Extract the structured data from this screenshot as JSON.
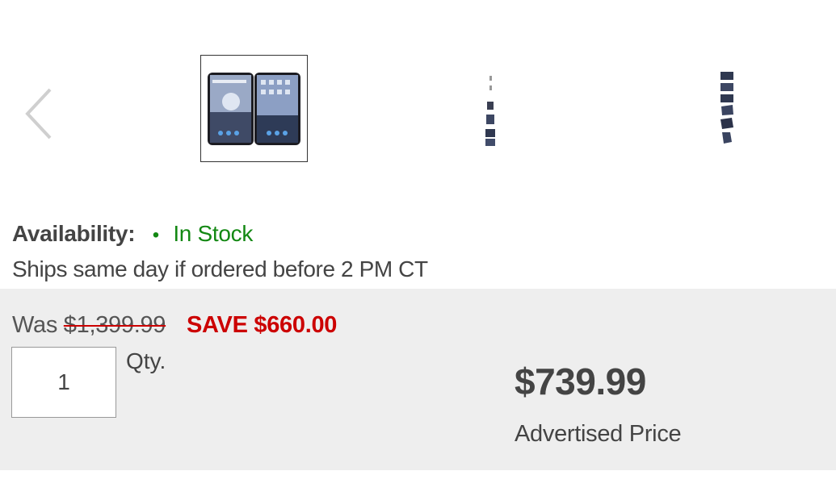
{
  "gallery": {
    "prev_icon": "chevron-left-icon",
    "thumbnails": [
      {
        "name": "surface-duo-open-front",
        "selected": true
      },
      {
        "name": "surface-duo-side-views",
        "selected": false
      },
      {
        "name": "surface-duo-angle-views",
        "selected": false
      }
    ]
  },
  "availability": {
    "label": "Availability:",
    "bullet": "•",
    "status": "In Stock",
    "shipping_note": "Ships same day if ordered before 2 PM CT"
  },
  "pricing": {
    "was_label": "Was",
    "original_price": "$1,399.99",
    "savings": "SAVE $660.00",
    "quantity_value": "1",
    "quantity_label": "Qty.",
    "current_price": "$739.99",
    "price_note": "Advertised Price"
  },
  "colors": {
    "in_stock": "#138813",
    "savings": "#cc0000",
    "panel_bg": "#eeeeee"
  }
}
